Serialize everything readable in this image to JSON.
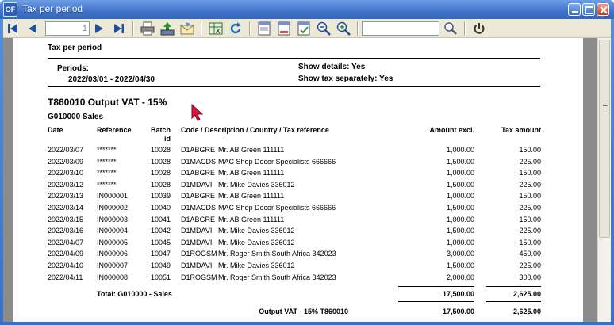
{
  "window": {
    "title": "Tax per period",
    "app_icon": "OF"
  },
  "toolbar": {
    "page_number": "1",
    "search_value": "",
    "icons": [
      "first-page-icon",
      "prev-page-icon",
      "next-page-icon",
      "last-page-icon",
      "print-icon",
      "export-icon",
      "email-icon",
      "excel-icon",
      "refresh-icon",
      "layout-icon",
      "layout-header-icon",
      "layout-check-icon",
      "zoom-out-icon",
      "zoom-in-icon",
      "search-icon",
      "power-icon"
    ]
  },
  "report": {
    "title": "Tax per period",
    "periods_label": "Periods:",
    "periods_value": "2022/03/01  -  2022/04/30",
    "show_details": "Show details: Yes",
    "show_tax_separately": "Show tax separately: Yes",
    "tax_heading": "T860010  Output VAT - 15%",
    "account_heading": "G010000   Sales",
    "columns": {
      "date": "Date",
      "reference": "Reference",
      "batch_1": "Batch",
      "batch_2": "id",
      "code": "Code / Description / Country / Tax reference",
      "amount": "Amount excl.",
      "tax": "Tax amount"
    },
    "rows": [
      {
        "date": "2022/03/07",
        "ref": "*******",
        "batch": "10028",
        "code": "D1ABGRE",
        "desc": "Mr. AB Green  111111",
        "amount": "1,000.00",
        "tax": "150.00"
      },
      {
        "date": "2022/03/09",
        "ref": "*******",
        "batch": "10028",
        "code": "D1MACDS",
        "desc": "MAC Shop Decor Specialists  666666",
        "amount": "1,500.00",
        "tax": "225.00"
      },
      {
        "date": "2022/03/10",
        "ref": "*******",
        "batch": "10028",
        "code": "D1ABGRE",
        "desc": "Mr. AB Green  111111",
        "amount": "1,000.00",
        "tax": "150.00"
      },
      {
        "date": "2022/03/12",
        "ref": "*******",
        "batch": "10028",
        "code": "D1MDAVI",
        "desc": "Mr. Mike Davies  336012",
        "amount": "1,500.00",
        "tax": "225.00"
      },
      {
        "date": "2022/03/13",
        "ref": "IN000001",
        "batch": "10039",
        "code": "D1ABGRE",
        "desc": "Mr. AB Green  111111",
        "amount": "1,000.00",
        "tax": "150.00"
      },
      {
        "date": "2022/03/14",
        "ref": "IN000002",
        "batch": "10040",
        "code": "D1MACDS",
        "desc": "MAC Shop Decor Specialists  666666",
        "amount": "1,500.00",
        "tax": "225.00"
      },
      {
        "date": "2022/03/15",
        "ref": "IN000003",
        "batch": "10041",
        "code": "D1ABGRE",
        "desc": "Mr. AB Green  111111",
        "amount": "1,000.00",
        "tax": "150.00"
      },
      {
        "date": "2022/03/16",
        "ref": "IN000004",
        "batch": "10042",
        "code": "D1MDAVI",
        "desc": "Mr. Mike Davies  336012",
        "amount": "1,500.00",
        "tax": "225.00"
      },
      {
        "date": "2022/04/07",
        "ref": "IN000005",
        "batch": "10045",
        "code": "D1MDAVI",
        "desc": "Mr. Mike Davies  336012",
        "amount": "1,000.00",
        "tax": "150.00"
      },
      {
        "date": "2022/04/09",
        "ref": "IN000006",
        "batch": "10047",
        "code": "D1ROGSM",
        "desc": "Mr. Roger Smith South Africa 342023",
        "amount": "3,000.00",
        "tax": "450.00"
      },
      {
        "date": "2022/04/10",
        "ref": "IN000007",
        "batch": "10049",
        "code": "D1MDAVI",
        "desc": "Mr. Mike Davies  336012",
        "amount": "1,500.00",
        "tax": "225.00"
      },
      {
        "date": "2022/04/11",
        "ref": "IN000008",
        "batch": "10051",
        "code": "D1ROGSM",
        "desc": "Mr. Roger Smith South Africa 342023",
        "amount": "2,000.00",
        "tax": "300.00"
      }
    ],
    "subtotal": {
      "label": "Total: G010000 - Sales",
      "amount": "17,500.00",
      "tax": "2,625.00"
    },
    "total": {
      "label": "Output VAT - 15% T860010",
      "amount": "17,500.00",
      "tax": "2,625.00"
    }
  }
}
